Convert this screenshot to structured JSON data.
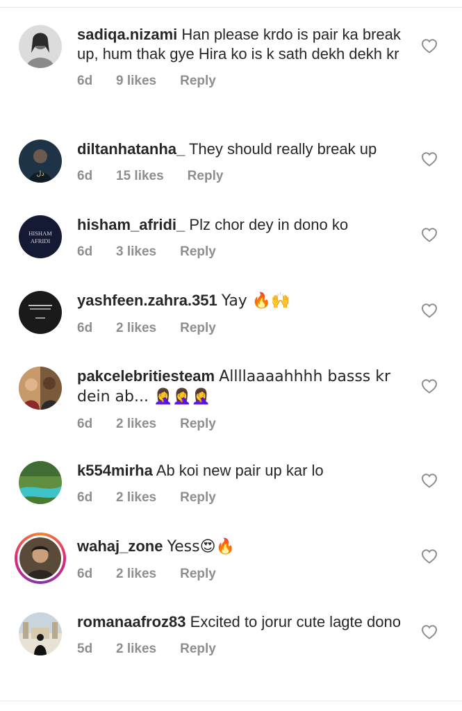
{
  "comments": [
    {
      "username": "sadiqa.nizami",
      "text": "Han please krdo is pair ka break up, hum thak gye Hira ko is k sath dekh dekh kr",
      "time": "6d",
      "likes": "9 likes",
      "reply": "Reply"
    },
    {
      "username": "diltanhatanha_",
      "text": "They should really break up",
      "time": "6d",
      "likes": "15 likes",
      "reply": "Reply"
    },
    {
      "username": "hisham_afridi_",
      "text": "Plz chor dey in dono ko",
      "time": "6d",
      "likes": "3 likes",
      "reply": "Reply",
      "avatar_text": [
        "HISHAM",
        "AFRIDI"
      ]
    },
    {
      "username": "yashfeen.zahra.351",
      "text": "Yay 🔥🙌",
      "time": "6d",
      "likes": "2 likes",
      "reply": "Reply"
    },
    {
      "username": "pakcelebritiesteam",
      "text": "Allllaaaahhhh basss kr dein ab... 🤦‍♀️🤦‍♀️🤦‍♀️",
      "time": "6d",
      "likes": "2 likes",
      "reply": "Reply"
    },
    {
      "username": "k554mirha",
      "text": "Ab koi new pair up kar lo",
      "time": "6d",
      "likes": "2 likes",
      "reply": "Reply"
    },
    {
      "username": "wahaj_zone",
      "text": "Yess😍🔥",
      "time": "6d",
      "likes": "2 likes",
      "reply": "Reply"
    },
    {
      "username": "romanaafroz83",
      "text": "Excited to jorur cute lagte dono",
      "time": "5d",
      "likes": "2 likes",
      "reply": "Reply"
    }
  ],
  "colors": {
    "text": "#262626",
    "meta": "#8e8e8e",
    "divider": "#e8e8e8"
  },
  "icons": {
    "like": "heart-outline-icon"
  }
}
